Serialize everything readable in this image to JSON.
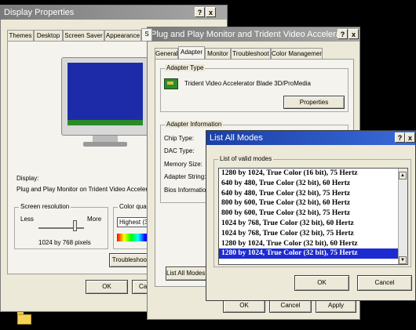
{
  "display_props": {
    "title": "Display Properties",
    "help": "?",
    "close": "x",
    "tabs": [
      "Themes",
      "Desktop",
      "Screen Saver",
      "Appearance",
      "S"
    ],
    "display_label": "Display:",
    "display_value": "Plug and Play Monitor on Trident Video Accelerator B",
    "screen_res": {
      "title": "Screen resolution",
      "less": "Less",
      "more": "More",
      "value": "1024 by 768 pixels"
    },
    "color_quality": {
      "title": "Color quality",
      "value": "Highest (32"
    },
    "troubleshoot": "Troubleshoot",
    "ok": "OK",
    "cancel": "Ca"
  },
  "adapter_props": {
    "title": "Plug and Play Monitor and Trident Video Accelerator Bla",
    "help": "?",
    "close": "x",
    "tabs": [
      "General",
      "Adapter",
      "Monitor",
      "Troubleshoot",
      "Color Management"
    ],
    "adapter_type": {
      "title": "Adapter Type",
      "name": "Trident Video Accelerator Blade 3D/ProMedia",
      "properties": "Properties"
    },
    "adapter_info": {
      "title": "Adapter Information",
      "rows": [
        "Chip Type:",
        "DAC Type:",
        "Memory Size:",
        "Adapter String:",
        "Bios Information:"
      ]
    },
    "list_all_modes": "List All Modes...",
    "ok": "OK",
    "cancel": "Cancel",
    "apply": "Apply"
  },
  "list_modes": {
    "title": "List All Modes",
    "help": "?",
    "close": "x",
    "group": "List of valid modes",
    "items": [
      "1280 by 1024, True Color (16 bit), 75 Hertz",
      "640 by 480, True Color (32 bit), 60 Hertz",
      "640 by 480, True Color (32 bit), 75 Hertz",
      "800 by 600, True Color (32 bit), 60 Hertz",
      "800 by 600, True Color (32 bit), 75 Hertz",
      "1024 by 768, True Color (32 bit), 60 Hertz",
      "1024 by 768, True Color (32 bit), 75 Hertz",
      "1280 by 1024, True Color (32 bit), 60 Hertz",
      "1280 by 1024, True Color (32 bit), 75 Hertz"
    ],
    "selected_index": 8,
    "ok": "OK",
    "cancel": "Cancel"
  }
}
